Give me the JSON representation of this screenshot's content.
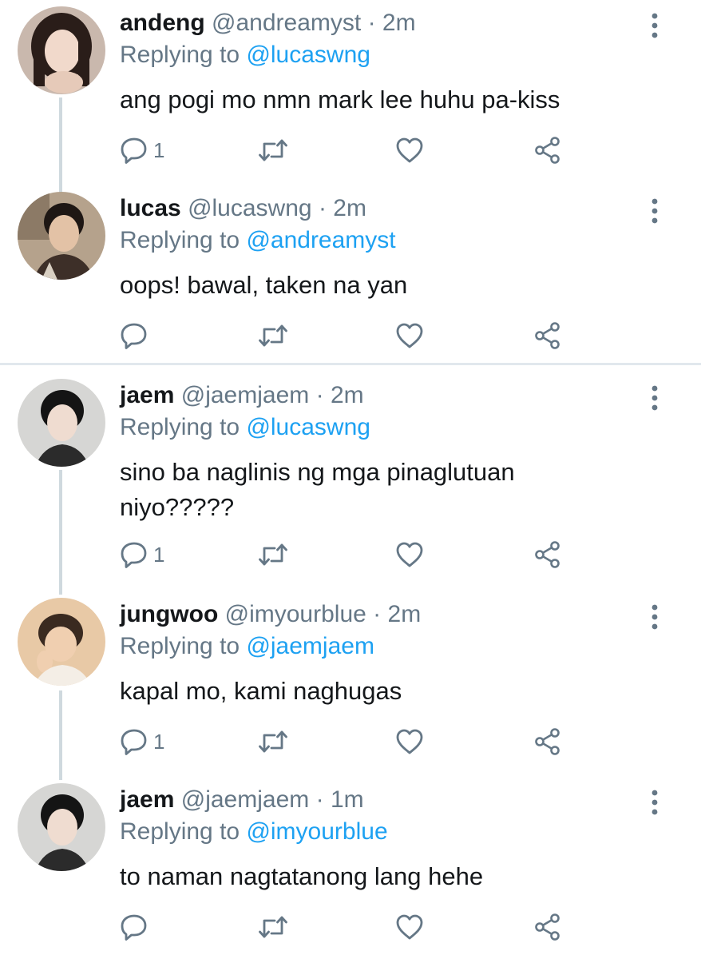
{
  "tweets": [
    {
      "name": "andeng",
      "handle": "@andreamyst",
      "sep": "·",
      "time": "2m",
      "replying_prefix": "Replying to",
      "replying_to": "@lucaswng",
      "text": "ang pogi mo nmn mark lee huhu pa-kiss",
      "reply_count": "1"
    },
    {
      "name": "lucas",
      "handle": "@lucaswng",
      "sep": "·",
      "time": "2m",
      "replying_prefix": "Replying to",
      "replying_to": "@andreamyst",
      "text": "oops! bawal, taken na yan",
      "reply_count": ""
    },
    {
      "name": "jaem",
      "handle": "@jaemjaem",
      "sep": "·",
      "time": "2m",
      "replying_prefix": "Replying to",
      "replying_to": "@lucaswng",
      "text": "sino ba naglinis ng mga pinaglutuan niyo?????",
      "reply_count": "1"
    },
    {
      "name": "jungwoo",
      "handle": "@imyourblue",
      "sep": "·",
      "time": "2m",
      "replying_prefix": "Replying to",
      "replying_to": "@jaemjaem",
      "text": "kapal mo, kami naghugas",
      "reply_count": "1"
    },
    {
      "name": "jaem",
      "handle": "@jaemjaem",
      "sep": "·",
      "time": "1m",
      "replying_prefix": "Replying to",
      "replying_to": "@imyourblue",
      "text": "to naman nagtatanong lang hehe",
      "reply_count": ""
    }
  ],
  "colors": {
    "link": "#1da1f2",
    "secondary": "#657786",
    "text": "#14171a",
    "thread_line": "#cfd9de",
    "divider": "#e1e8ed"
  },
  "icons": [
    "reply-icon",
    "retweet-icon",
    "like-icon",
    "share-icon",
    "more-options-icon"
  ]
}
